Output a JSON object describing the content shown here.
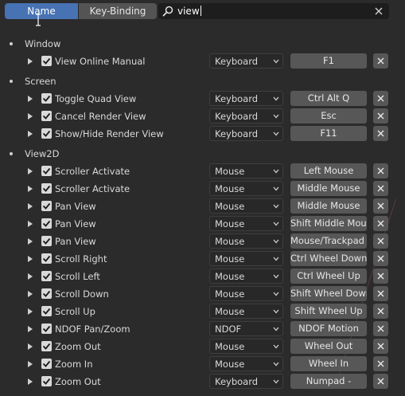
{
  "toolbar": {
    "tab_name": "Name",
    "tab_keybinding": "Key-Binding",
    "search_value": "view"
  },
  "categories": [
    {
      "name": "Window",
      "items": [
        {
          "label": "View Online Manual",
          "type": "Keyboard",
          "key": "F1"
        }
      ]
    },
    {
      "name": "Screen",
      "items": [
        {
          "label": "Toggle Quad View",
          "type": "Keyboard",
          "key": "Ctrl Alt Q"
        },
        {
          "label": "Cancel Render View",
          "type": "Keyboard",
          "key": "Esc"
        },
        {
          "label": "Show/Hide Render View",
          "type": "Keyboard",
          "key": "F11"
        }
      ]
    },
    {
      "name": "View2D",
      "items": [
        {
          "label": "Scroller Activate",
          "type": "Mouse",
          "key": "Left Mouse"
        },
        {
          "label": "Scroller Activate",
          "type": "Mouse",
          "key": "Middle Mouse"
        },
        {
          "label": "Pan View",
          "type": "Mouse",
          "key": "Middle Mouse"
        },
        {
          "label": "Pan View",
          "type": "Mouse",
          "key": "Shift Middle Mouse"
        },
        {
          "label": "Pan View",
          "type": "Mouse",
          "key": "Mouse/Trackpad ..."
        },
        {
          "label": "Scroll Right",
          "type": "Mouse",
          "key": "Ctrl Wheel Down"
        },
        {
          "label": "Scroll Left",
          "type": "Mouse",
          "key": "Ctrl Wheel Up"
        },
        {
          "label": "Scroll Down",
          "type": "Mouse",
          "key": "Shift Wheel Down"
        },
        {
          "label": "Scroll Up",
          "type": "Mouse",
          "key": "Shift Wheel Up"
        },
        {
          "label": "NDOF Pan/Zoom",
          "type": "NDOF",
          "key": "NDOF Motion"
        },
        {
          "label": "Zoom Out",
          "type": "Mouse",
          "key": "Wheel Out"
        },
        {
          "label": "Zoom In",
          "type": "Mouse",
          "key": "Wheel In"
        },
        {
          "label": "Zoom Out",
          "type": "Keyboard",
          "key": "Numpad -"
        }
      ]
    }
  ],
  "colors": {
    "accent": "#4772b3",
    "background": "#2b2b2b",
    "button": "#575757"
  },
  "icons": {
    "search": "magnifier-icon",
    "clear": "close-icon",
    "expand": "triangle-right-icon",
    "enabled": "checkbox-checked-icon",
    "dropdown": "chevron-down-icon",
    "remove": "close-icon"
  }
}
